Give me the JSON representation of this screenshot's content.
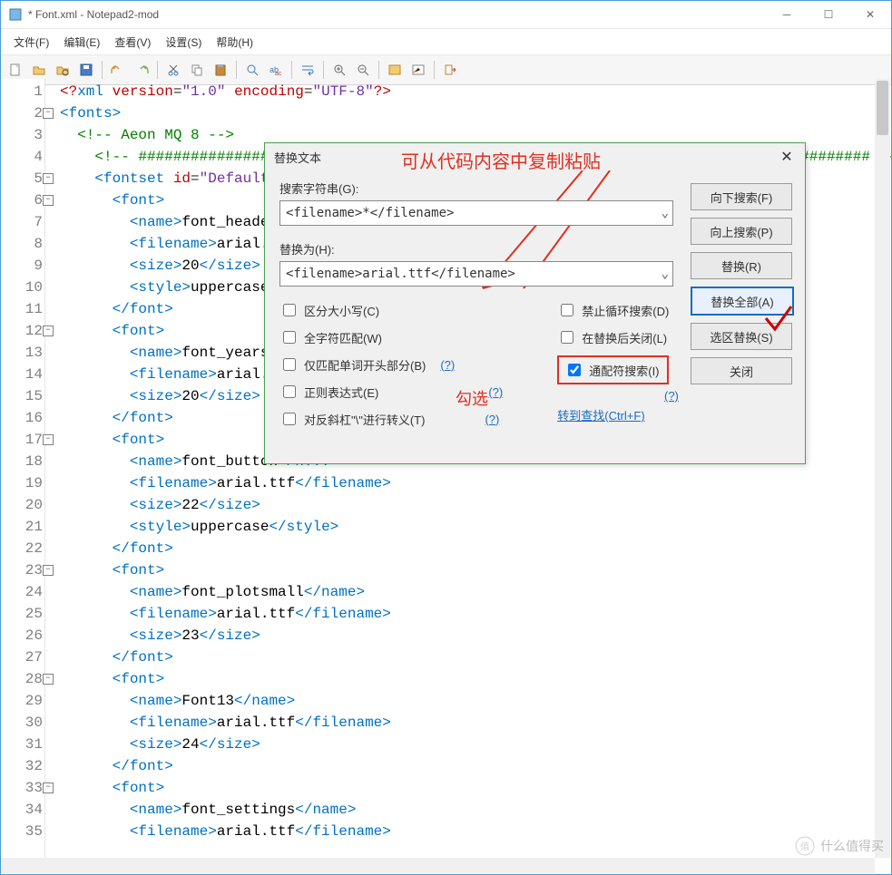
{
  "title": "* Font.xml - Notepad2-mod",
  "menus": [
    "文件(F)",
    "编辑(E)",
    "查看(V)",
    "设置(S)",
    "帮助(H)"
  ],
  "lines": [
    {
      "n": 1,
      "html": "<span class='pi'>&lt;?</span><span class='tg'>xml</span> <span class='at'>version</span>=<span class='st'>\"1.0\"</span> <span class='at'>encoding</span>=<span class='st'>\"UTF-8\"</span><span class='pi'>?&gt;</span>"
    },
    {
      "n": 2,
      "fold": true,
      "html": "<span class='tg'>&lt;fonts&gt;</span>"
    },
    {
      "n": 3,
      "html": "  <span class='cm'>&lt;!-- Aeon MQ 8 --&gt;</span>"
    },
    {
      "n": 4,
      "html": "    <span class='cm'>&lt;!-- #################################################################################### --&gt;</span>"
    },
    {
      "n": 5,
      "fold": true,
      "html": "    <span class='tg'>&lt;fontset</span> <span class='at'>id</span>=<span class='st'>\"Default\"</span>"
    },
    {
      "n": 6,
      "fold": true,
      "html": "      <span class='tg'>&lt;font&gt;</span>"
    },
    {
      "n": 7,
      "html": "        <span class='tg'>&lt;name&gt;</span><span class='tx'>font_headersma</span>"
    },
    {
      "n": 8,
      "html": "        <span class='tg'>&lt;filename&gt;</span><span class='tx'>arial.ttf</span>"
    },
    {
      "n": 9,
      "html": "        <span class='tg'>&lt;size&gt;</span><span class='tx'>20</span><span class='tg'>&lt;/size&gt;</span>"
    },
    {
      "n": 10,
      "html": "        <span class='tg'>&lt;style&gt;</span><span class='tx'>uppercase</span><span class='tg'>&lt;/st</span>"
    },
    {
      "n": 11,
      "html": "      <span class='tg'>&lt;/font&gt;</span>"
    },
    {
      "n": 12,
      "fold": true,
      "html": "      <span class='tg'>&lt;font&gt;</span>"
    },
    {
      "n": 13,
      "html": "        <span class='tg'>&lt;name&gt;</span><span class='tx'>font_yearshome</span>"
    },
    {
      "n": 14,
      "html": "        <span class='tg'>&lt;filename&gt;</span><span class='tx'>arial.ttf</span>"
    },
    {
      "n": 15,
      "html": "        <span class='tg'>&lt;size&gt;</span><span class='tx'>20</span><span class='tg'>&lt;/size&gt;</span>"
    },
    {
      "n": 16,
      "html": "      <span class='tg'>&lt;/font&gt;</span>"
    },
    {
      "n": 17,
      "fold": true,
      "html": "      <span class='tg'>&lt;font&gt;</span>"
    },
    {
      "n": 18,
      "html": "        <span class='tg'>&lt;name&gt;</span><span class='tx'>font_button</span><span class='tg'>&lt;/n...</span>"
    },
    {
      "n": 19,
      "html": "        <span class='tg'>&lt;filename&gt;</span><span class='tx'>arial.ttf</span><span class='tg'>&lt;/filename&gt;</span>"
    },
    {
      "n": 20,
      "html": "        <span class='tg'>&lt;size&gt;</span><span class='tx'>22</span><span class='tg'>&lt;/size&gt;</span>"
    },
    {
      "n": 21,
      "html": "        <span class='tg'>&lt;style&gt;</span><span class='tx'>uppercase</span><span class='tg'>&lt;/style&gt;</span>"
    },
    {
      "n": 22,
      "html": "      <span class='tg'>&lt;/font&gt;</span>"
    },
    {
      "n": 23,
      "fold": true,
      "html": "      <span class='tg'>&lt;font&gt;</span>"
    },
    {
      "n": 24,
      "html": "        <span class='tg'>&lt;name&gt;</span><span class='tx'>font_plotsmall</span><span class='tg'>&lt;/name&gt;</span>"
    },
    {
      "n": 25,
      "html": "        <span class='tg'>&lt;filename&gt;</span><span class='tx'>arial.ttf</span><span class='tg'>&lt;/filename&gt;</span>"
    },
    {
      "n": 26,
      "html": "        <span class='tg'>&lt;size&gt;</span><span class='tx'>23</span><span class='tg'>&lt;/size&gt;</span>"
    },
    {
      "n": 27,
      "html": "      <span class='tg'>&lt;/font&gt;</span>"
    },
    {
      "n": 28,
      "fold": true,
      "html": "      <span class='tg'>&lt;font&gt;</span>"
    },
    {
      "n": 29,
      "html": "        <span class='tg'>&lt;name&gt;</span><span class='tx'>Font13</span><span class='tg'>&lt;/name&gt;</span>"
    },
    {
      "n": 30,
      "html": "        <span class='tg'>&lt;filename&gt;</span><span class='tx'>arial.ttf</span><span class='tg'>&lt;/filename&gt;</span>"
    },
    {
      "n": 31,
      "html": "        <span class='tg'>&lt;size&gt;</span><span class='tx'>24</span><span class='tg'>&lt;/size&gt;</span>"
    },
    {
      "n": 32,
      "html": "      <span class='tg'>&lt;/font&gt;</span>"
    },
    {
      "n": 33,
      "fold": true,
      "html": "      <span class='tg'>&lt;font&gt;</span>"
    },
    {
      "n": 34,
      "html": "        <span class='tg'>&lt;name&gt;</span><span class='tx'>font_settings</span><span class='tg'>&lt;/name&gt;</span>"
    },
    {
      "n": 35,
      "html": "        <span class='tg'>&lt;filename&gt;</span><span class='tx'>arial.ttf</span><span class='tg'>&lt;/filename&gt;</span>"
    }
  ],
  "dialog": {
    "title": "替换文本",
    "search_label": "搜索字符串(G):",
    "search_value": "<filename>*</filename>",
    "replace_label": "替换为(H):",
    "replace_value": "<filename>arial.ttf</filename>",
    "btn_down": "向下搜索(F)",
    "btn_up": "向上搜索(P)",
    "btn_replace": "替换(R)",
    "btn_replace_all": "替换全部(A)",
    "btn_sel": "选区替换(S)",
    "btn_close": "关闭",
    "checks_left": [
      "区分大小写(C)",
      "全字符匹配(W)",
      "仅匹配单词开头部分(B)",
      "正则表达式(E)",
      "对反斜杠\"\\\"进行转义(T)"
    ],
    "checks_right": [
      "禁止循环搜索(D)",
      "在替换后关闭(L)",
      "通配符搜索(I)"
    ],
    "help": "(?)",
    "goto_find": "转到查找(Ctrl+F)"
  },
  "anno1": "可从代码内容中复制粘贴",
  "anno2": "勾选",
  "watermark": "什么值得买"
}
